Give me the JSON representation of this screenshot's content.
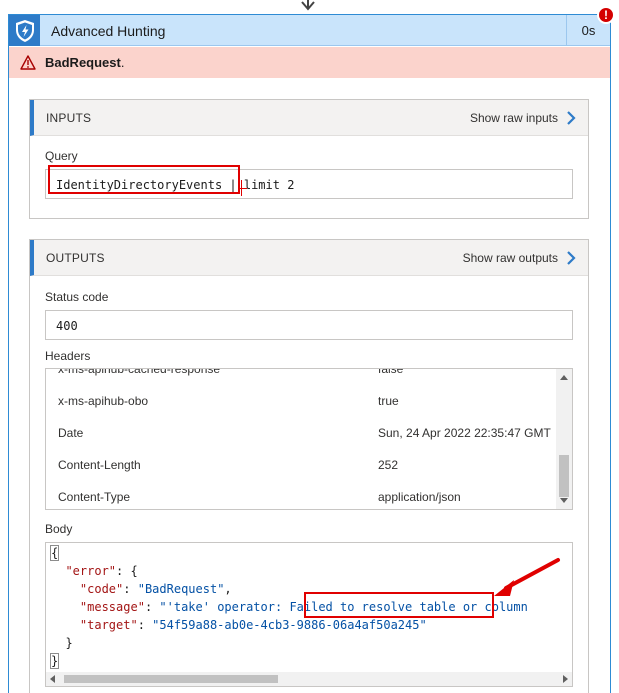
{
  "card": {
    "title": "Advanced Hunting",
    "duration": "0s",
    "error_badge": "!"
  },
  "error_banner": {
    "text_bold": "BadRequest",
    "text_suffix": "."
  },
  "inputs": {
    "label": "INPUTS",
    "show_raw_label": "Show raw inputs",
    "query_label": "Query",
    "query_table": "IdentityDirectoryEvents",
    "query_rest": " | limit 2"
  },
  "outputs": {
    "label": "OUTPUTS",
    "show_raw_label": "Show raw outputs",
    "status_code_label": "Status code",
    "status_code_value": "400",
    "headers_label": "Headers",
    "headers": [
      {
        "key": "x-ms-apihub-cached-response",
        "value": "false"
      },
      {
        "key": "x-ms-apihub-obo",
        "value": "true"
      },
      {
        "key": "Date",
        "value": "Sun, 24 Apr 2022 22:35:47 GMT"
      },
      {
        "key": "Content-Length",
        "value": "252"
      },
      {
        "key": "Content-Type",
        "value": "application/json"
      }
    ],
    "body_label": "Body",
    "body": {
      "open_brace": "{",
      "error_key": "\"error\"",
      "error_open": ": {",
      "code_key": "\"code\"",
      "code_value": "\"BadRequest\"",
      "message_key": "\"message\"",
      "message_prefix": "\"'take' operator: ",
      "message_highlight": "Failed to resolve table",
      "message_suffix": " or column",
      "target_key": "\"target\"",
      "target_value": "\"54f59a88-ab0e-4cb3-9886-06a4af50a245\"",
      "inner_close": "}",
      "close_brace": "}"
    }
  },
  "colors": {
    "accent": "#2e7bc8",
    "title_bg": "#c9e4fb",
    "error_bg": "#fbd3cc",
    "annotation_red": "#e00000"
  }
}
